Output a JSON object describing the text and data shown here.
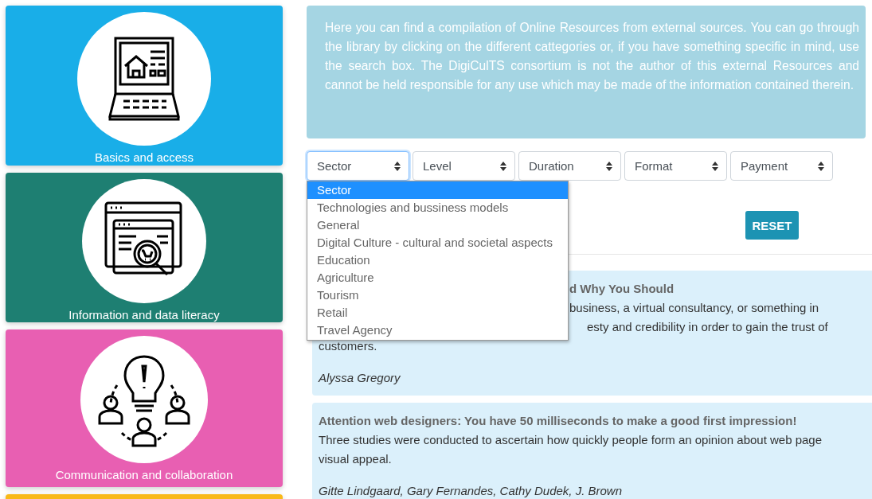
{
  "categories": [
    {
      "label": "Basics and access",
      "color": "#19aee8"
    },
    {
      "label": "Information and data literacy",
      "color": "#1e7f72"
    },
    {
      "label": "Communication and collaboration",
      "color": "#e85fb2"
    },
    {
      "color": "#f9b919"
    }
  ],
  "intro": "Here you can find a compilation of Online Resources from external sources. You can go through the library by clicking on the different cattegories or, if you have something specific in mind, use the search box. The DigiCulTS consortium is not the author of this external Resources and cannot be held responsible for any use which may be made of the information contained therein.",
  "filters": [
    {
      "label": "Sector",
      "expanded": true
    },
    {
      "label": "Level",
      "expanded": false
    },
    {
      "label": "Duration",
      "expanded": false
    },
    {
      "label": "Format",
      "expanded": false
    },
    {
      "label": "Payment",
      "expanded": false
    }
  ],
  "dropdown_options": [
    {
      "label": "Sector",
      "selected": true
    },
    {
      "label": "Technologies and bussiness models",
      "selected": false
    },
    {
      "label": "General",
      "selected": false
    },
    {
      "label": "Digital Culture - cultural and societal aspects",
      "selected": false
    },
    {
      "label": "Education",
      "selected": false
    },
    {
      "label": "Agriculture",
      "selected": false
    },
    {
      "label": "Tourism",
      "selected": false
    },
    {
      "label": "Retail",
      "selected": false
    },
    {
      "label": "Travel Agency",
      "selected": false
    }
  ],
  "reset_button": "RESET",
  "resources": [
    {
      "title": "d Why You Should",
      "body_lines": [
        "business, a virtual consultancy, or something in",
        "esty and credibility in order to gain the trust of",
        "customers."
      ],
      "authors": "Alyssa Gregory"
    },
    {
      "title": "Attention web designers: You have 50 milliseconds to make a good first impression!",
      "body_lines": [
        "Three studies were conducted to ascertain how quickly people form an opinion about web page",
        "visual appeal."
      ],
      "authors": "Gitte Lindgaard, Gary Fernandes, Cathy Dudek, J. Brown"
    }
  ]
}
